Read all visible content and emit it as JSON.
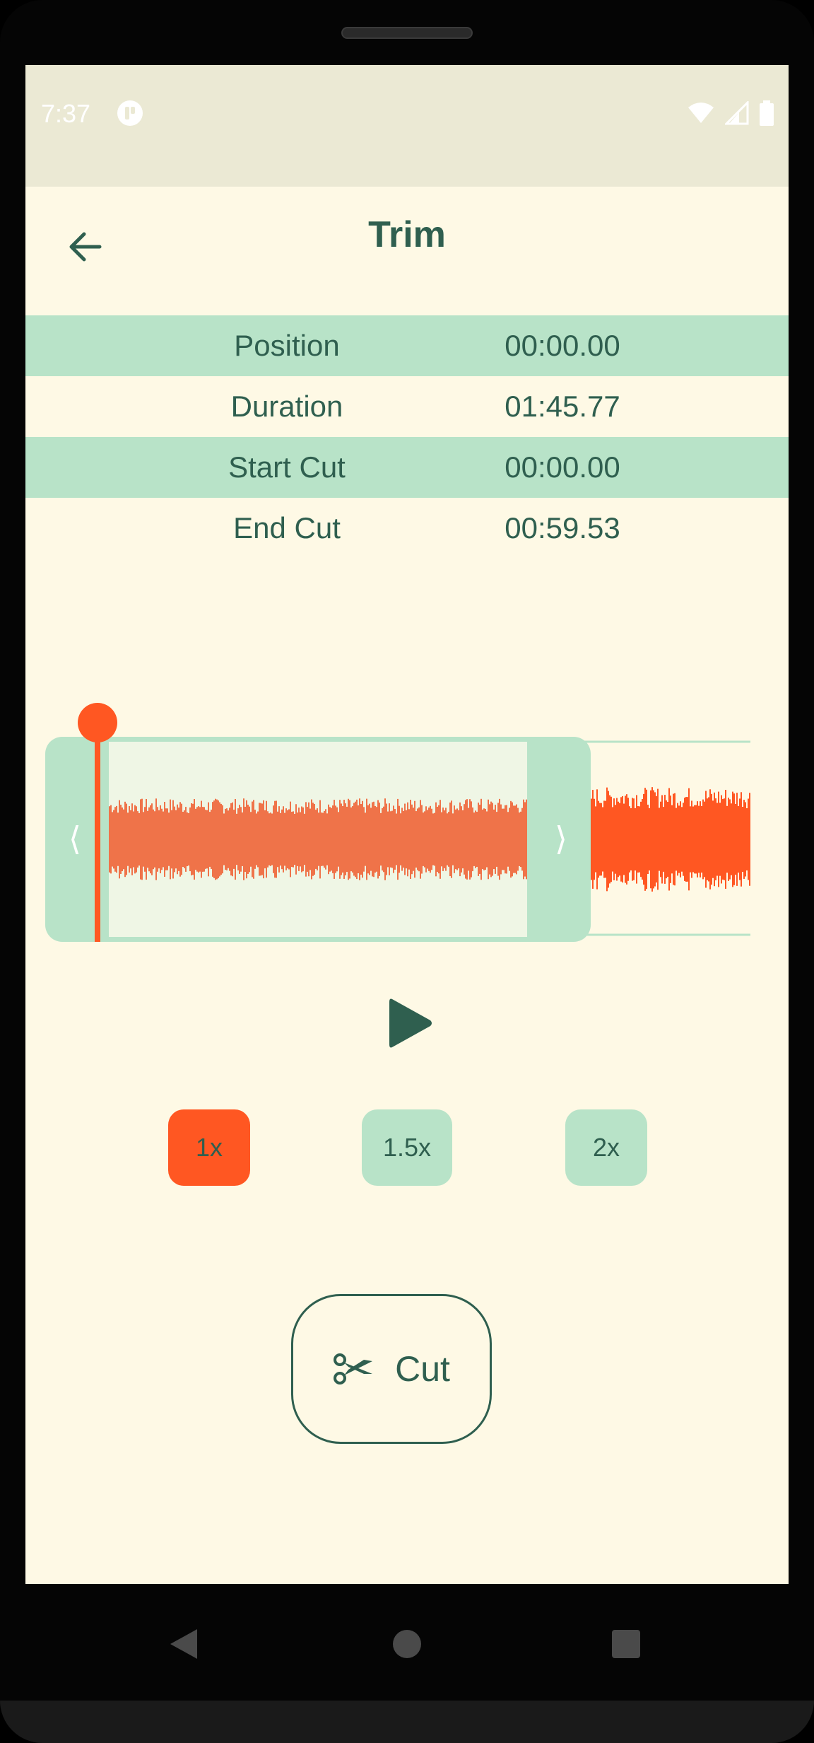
{
  "status_bar": {
    "time": "7:37"
  },
  "app_bar": {
    "title": "Trim"
  },
  "info": [
    {
      "label": "Position",
      "value": "00:00.00"
    },
    {
      "label": "Duration",
      "value": "01:45.77"
    },
    {
      "label": "Start Cut",
      "value": "00:00.00"
    },
    {
      "label": "End Cut",
      "value": "00:59.53"
    }
  ],
  "waveform": {
    "left_handle_glyph": "⟨",
    "right_handle_glyph": "⟩",
    "colors": {
      "selected": "#EF7349",
      "unselected": "#FF5722",
      "handle": "#B8E3C8",
      "playhead": "#FF5722"
    }
  },
  "controls": {
    "play_icon": "play-icon"
  },
  "speeds": [
    {
      "label": "1x",
      "active": true
    },
    {
      "label": "1.5x",
      "active": false
    },
    {
      "label": "2x",
      "active": false
    }
  ],
  "cut_button": {
    "label": "Cut",
    "icon": "scissors-icon"
  },
  "colors": {
    "accent": "#FF5722",
    "primary_text": "#2F5F4F",
    "background": "#FEF9E5",
    "row_shade": "#B8E3C8"
  }
}
